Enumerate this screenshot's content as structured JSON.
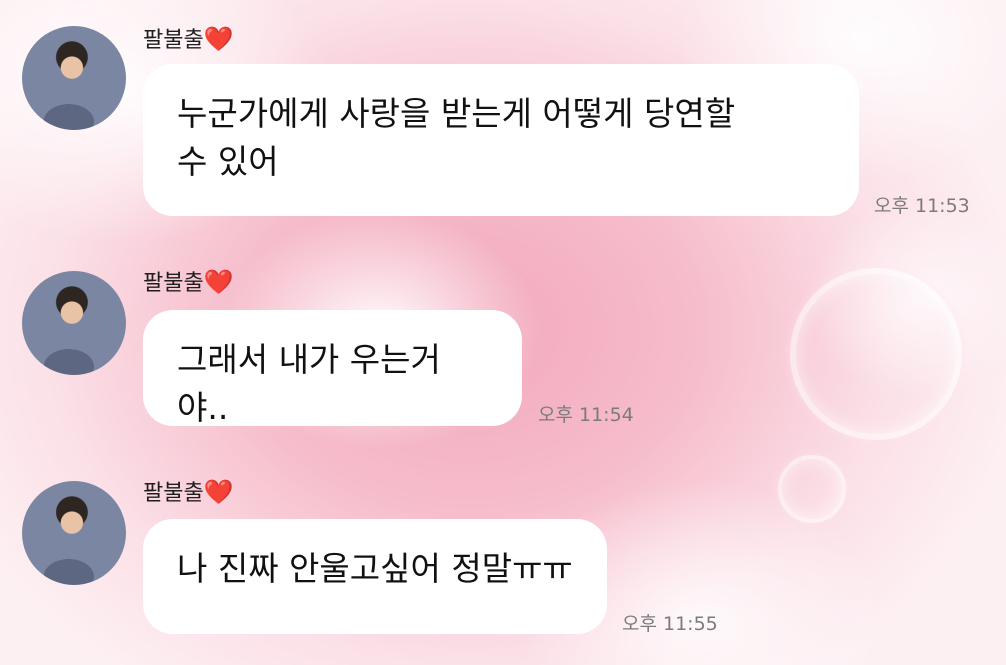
{
  "chat": {
    "messages": [
      {
        "sender": "팔불출",
        "sender_emoji": "❤️",
        "text": "누군가에게 사랑을 받는게 어떻게 당연할 수 있어",
        "time": "오후 11:53"
      },
      {
        "sender": "팔불출",
        "sender_emoji": "❤️",
        "text": "그래서 내가 우는거야..",
        "time": "오후 11:54"
      },
      {
        "sender": "팔불출",
        "sender_emoji": "❤️",
        "text": "나 진짜 안울고싶어 정말ㅠㅠ",
        "time": "오후 11:55"
      }
    ]
  },
  "colors": {
    "bubble": "#ffffff",
    "heart": "#e3263b",
    "timestamp": "#7b7b7b",
    "background": "#f6bccb"
  },
  "icons": {
    "avatar": "profile-photo",
    "sender_emoji": "red-heart-icon"
  }
}
